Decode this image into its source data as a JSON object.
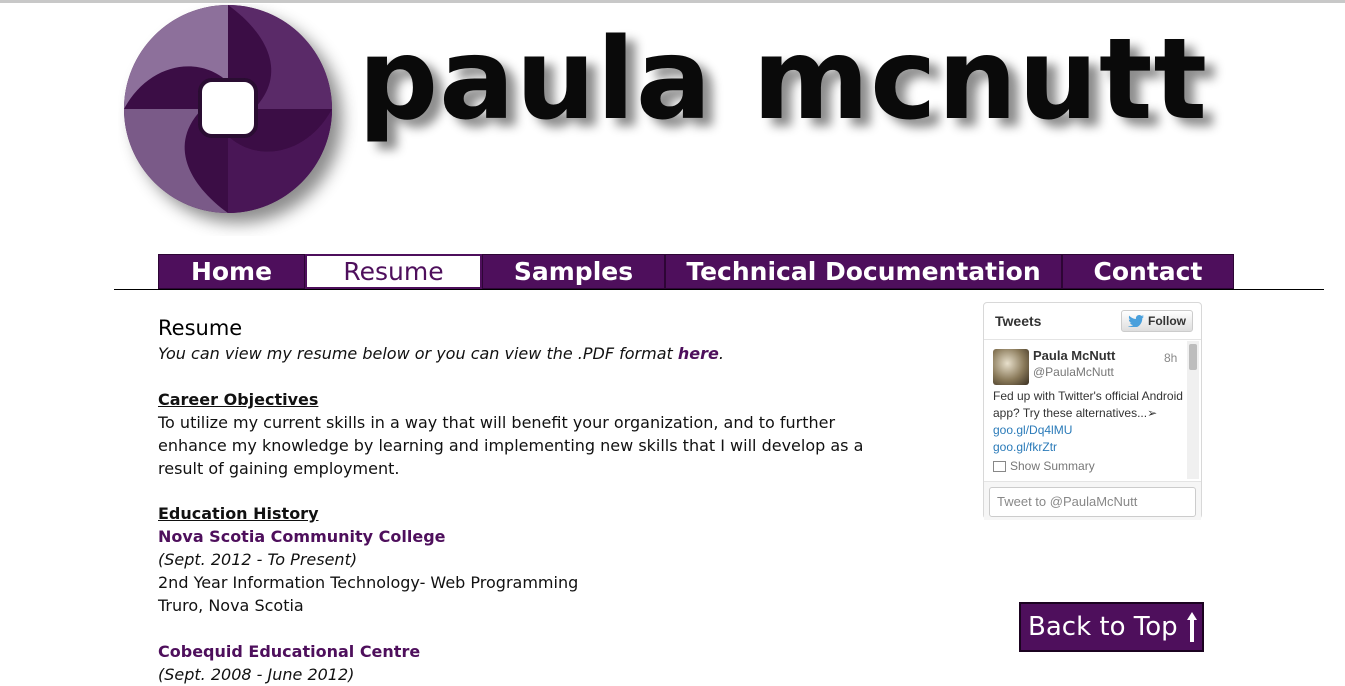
{
  "logo": {
    "text": "paula mcnutt",
    "colors": {
      "primary": "#4e0f5c",
      "light": "#8a6a98"
    }
  },
  "nav": {
    "items": [
      {
        "label": "Home",
        "active": false
      },
      {
        "label": "Resume",
        "active": true
      },
      {
        "label": "Samples",
        "active": false
      },
      {
        "label": "Technical Documentation",
        "active": false
      },
      {
        "label": "Contact",
        "active": false
      }
    ],
    "accent": "#4e0f5c"
  },
  "content": {
    "title": "Resume",
    "intro": {
      "before": "You can view my resume below or you can view the .PDF format ",
      "link": "here",
      "after": "."
    },
    "career": {
      "heading": "Career Objectives",
      "text": "To utilize my current skills in a way that will benefit your organization, and to further enhance my knowledge by learning and implementing new skills that I will develop as a result of gaining employment."
    },
    "education": {
      "heading": "Education History",
      "schools": [
        {
          "name": "Nova Scotia Community College",
          "dates": "(Sept. 2012 - To Present)",
          "program": "2nd Year Information Technology- Web Programming",
          "location": "Truro, Nova Scotia"
        },
        {
          "name": "Cobequid Educational Centre",
          "dates": "(Sept. 2008 - June 2012)"
        }
      ]
    }
  },
  "twitter": {
    "title": "Tweets",
    "follow_label": "Follow",
    "tweet": {
      "name": "Paula McNutt",
      "handle": "@PaulaMcNutt",
      "time": "8h",
      "text": "Fed up with Twitter's official Android app? Try these alternatives...➢ ",
      "link1": "goo.gl/Dq4lMU",
      "link2": "goo.gl/fkrZtr",
      "summary": "Show Summary"
    },
    "compose_placeholder": "Tweet to @PaulaMcNutt"
  },
  "back_to_top": {
    "label": "Back to Top"
  }
}
